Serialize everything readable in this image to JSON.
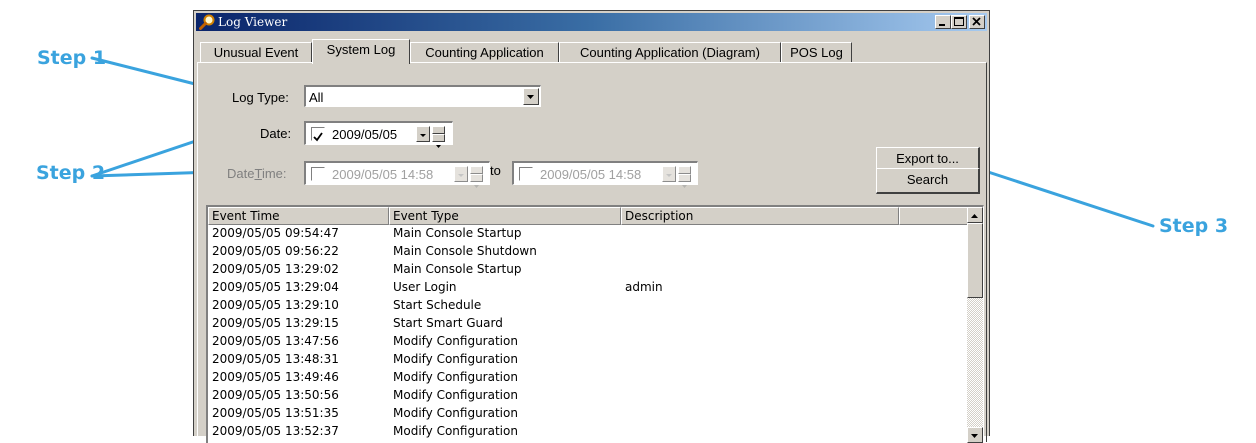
{
  "annotations": {
    "step1": "Step 1",
    "step2": "Step 2",
    "step3": "Step 3"
  },
  "window": {
    "title": "Log Viewer"
  },
  "tabs": [
    {
      "label": "Unusual Event"
    },
    {
      "label": "System Log",
      "active": true
    },
    {
      "label": "Counting Application"
    },
    {
      "label": "Counting Application (Diagram)"
    },
    {
      "label": "POS Log"
    }
  ],
  "filters": {
    "log_type_label": "Log Type:",
    "log_type_value": "All",
    "date_label": "Date:",
    "date_value": "2009/05/05",
    "date_checked": true,
    "datetime_label": "DateTime:",
    "datetime_from": "2009/05/05 14:58",
    "datetime_to_label": "to",
    "datetime_to": "2009/05/05 14:58"
  },
  "buttons": {
    "export": "Export to...",
    "search": "Search"
  },
  "table": {
    "columns": [
      "Event Time",
      "Event Type",
      "Description"
    ],
    "rows": [
      [
        "2009/05/05 09:54:47",
        "Main Console Startup",
        ""
      ],
      [
        "2009/05/05 09:56:22",
        "Main Console Shutdown",
        ""
      ],
      [
        "2009/05/05 13:29:02",
        "Main Console Startup",
        ""
      ],
      [
        "2009/05/05 13:29:04",
        "User Login",
        "admin"
      ],
      [
        "2009/05/05 13:29:10",
        "Start Schedule",
        ""
      ],
      [
        "2009/05/05 13:29:15",
        "Start Smart Guard",
        ""
      ],
      [
        "2009/05/05 13:47:56",
        "Modify Configuration",
        ""
      ],
      [
        "2009/05/05 13:48:31",
        "Modify Configuration",
        ""
      ],
      [
        "2009/05/05 13:49:46",
        "Modify Configuration",
        ""
      ],
      [
        "2009/05/05 13:50:56",
        "Modify Configuration",
        ""
      ],
      [
        "2009/05/05 13:51:35",
        "Modify Configuration",
        ""
      ],
      [
        "2009/05/05 13:52:37",
        "Modify Configuration",
        ""
      ]
    ]
  },
  "colors": {
    "annotation": "#3aa3de",
    "titlebar": "#0a246a",
    "face": "#d4d0c8"
  }
}
